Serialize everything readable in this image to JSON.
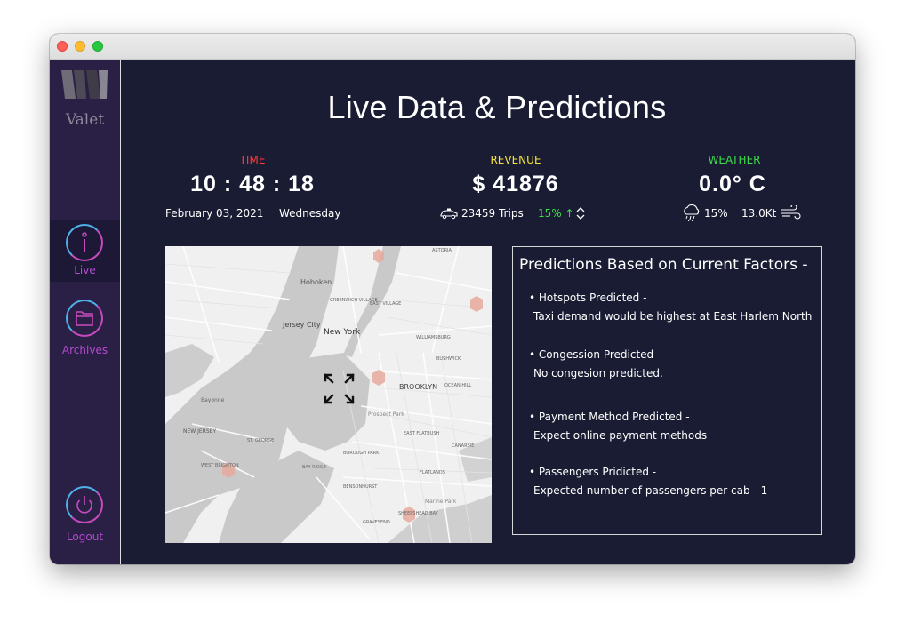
{
  "app": {
    "logo_text": "Valet"
  },
  "sidebar": {
    "items": [
      {
        "label": "Live",
        "icon": "info-icon",
        "active": true
      },
      {
        "label": "Archives",
        "icon": "folder-icon",
        "active": false
      },
      {
        "label": "Logout",
        "icon": "power-icon",
        "active": false
      }
    ]
  },
  "header": {
    "title": "Live Data & Predictions"
  },
  "stats": {
    "time": {
      "label": "TIME",
      "value": "10 : 48 : 18",
      "date": "February 03, 2021",
      "weekday": "Wednesday",
      "label_color": "#ff3b3b"
    },
    "revenue": {
      "label": "REVENUE",
      "value": "$ 41876",
      "trips": "23459 Trips",
      "change": "15% ↑",
      "label_color": "#f5e23c",
      "change_color": "#3ddc4a"
    },
    "weather": {
      "label": "WEATHER",
      "value": "0.0° C",
      "precip": "15%",
      "wind": "13.0Kt",
      "label_color": "#3ddc4a"
    }
  },
  "map": {
    "labels": {
      "hoboken": "Hoboken",
      "jersey_city": "Jersey City",
      "new_york": "New York",
      "brooklyn": "BROOKLYN",
      "new_jersey": "NEW JERSEY",
      "west_brighton": "WEST BRIGHTON",
      "bayonne": "Bayonne",
      "prospect_park": "Prospect Park",
      "marine_park": "Marine Park",
      "greenwich_village": "GREENWICH VILLAGE",
      "east_village": "EAST VILLAGE",
      "williamsburg": "WILLIAMSBURG",
      "bushwick": "BUSHWICK",
      "astoria": "ASTORIA",
      "east_flatbush": "EAST FLATBUSH",
      "canarsie": "CANARSIE",
      "flatlands": "FLATLANDS",
      "bay_ridge": "BAY RIDGE",
      "bensonhurst": "BENSONHURST",
      "gravesend": "GRAVESEND",
      "sheepshead_bay": "SHEEPSHEAD BAY",
      "st_george": "ST. GEORGE",
      "ocean_hill": "OCEAN HILL",
      "borough_park": "BOROUGH PARK"
    }
  },
  "predictions": {
    "title": "Predictions Based on Current Factors -",
    "items": [
      {
        "heading": "• Hotspots Predicted -",
        "text": "Taxi demand would be highest at East Harlem North"
      },
      {
        "heading": "• Congession Predicted -",
        "text": "No congesion predicted."
      },
      {
        "heading": "• Payment Method Predicted -",
        "text": "Expect online payment methods"
      },
      {
        "heading": "• Passengers Pridicted -",
        "text": "Expected number of passengers per cab - 1"
      }
    ]
  }
}
